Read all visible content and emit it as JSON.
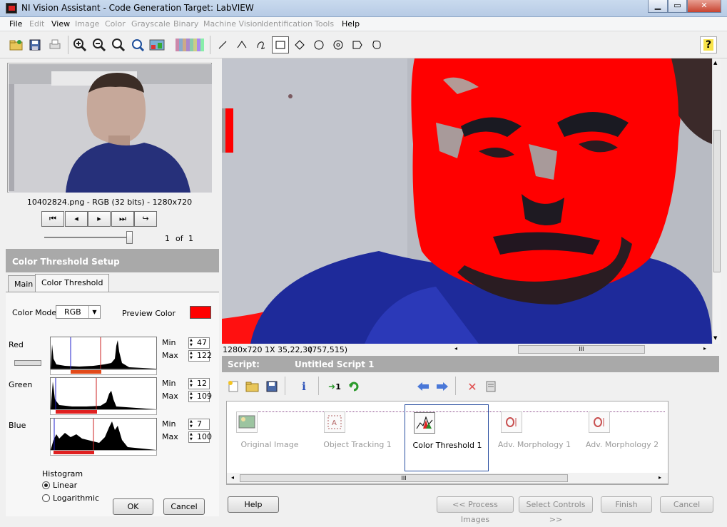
{
  "window": {
    "title": "NI Vision Assistant - Code Generation Target: LabVIEW"
  },
  "menu": [
    {
      "label": "File",
      "enabled": true
    },
    {
      "label": "Edit",
      "enabled": false
    },
    {
      "label": "View",
      "enabled": true
    },
    {
      "label": "Image",
      "enabled": false
    },
    {
      "label": "Color",
      "enabled": false
    },
    {
      "label": "Grayscale",
      "enabled": false
    },
    {
      "label": "Binary",
      "enabled": false
    },
    {
      "label": "Machine Vision",
      "enabled": false
    },
    {
      "label": "Identification",
      "enabled": false
    },
    {
      "label": "Tools",
      "enabled": false
    },
    {
      "label": "Help",
      "enabled": true
    }
  ],
  "browser": {
    "image_info": "10402824.png - RGB (32 bits) - 1280x720",
    "page_current": "1",
    "page_of": "of",
    "page_total": "1"
  },
  "setup": {
    "header": "Color Threshold Setup",
    "tabs": [
      "Main",
      "Color Threshold"
    ],
    "color_model_label": "Color Model",
    "color_model_value": "RGB",
    "preview_color_label": "Preview Color",
    "preview_color": "#ff0000",
    "channels": [
      {
        "name": "Red",
        "min_label": "Min",
        "min": "47",
        "max_label": "Max",
        "max": "122"
      },
      {
        "name": "Green",
        "min_label": "Min",
        "min": "12",
        "max_label": "Max",
        "max": "109"
      },
      {
        "name": "Blue",
        "min_label": "Min",
        "min": "7",
        "max_label": "Max",
        "max": "100"
      }
    ],
    "histogram_label": "Histogram",
    "histogram_options": [
      "Linear",
      "Logarithmic"
    ],
    "histogram_selected": "Linear",
    "ok_label": "OK",
    "cancel_label": "Cancel"
  },
  "viewer": {
    "status_size": "1280x720 1X 35,22,30",
    "status_coord": "(757,515)",
    "h_scroll_thumb": "III"
  },
  "script": {
    "label": "Script:",
    "name": "Untitled Script 1",
    "run_label": "1",
    "steps": [
      {
        "label": "Original Image",
        "active": false
      },
      {
        "label": "Object Tracking 1",
        "active": false
      },
      {
        "label": "Color Threshold 1",
        "active": true
      },
      {
        "label": "Adv. Morphology 1",
        "active": false
      },
      {
        "label": "Adv. Morphology 2",
        "active": false
      }
    ],
    "scroll_thumb": "III"
  },
  "footer": {
    "help_label": "Help",
    "process_label": "<< Process Images",
    "select_controls_label": "Select Controls >>",
    "finish_label": "Finish",
    "cancel_label": "Cancel"
  },
  "colors": {
    "threshold_overlay": "#ff0000",
    "header_gray": "#a9a9a9",
    "selection_blue": "#2a4fa1"
  }
}
